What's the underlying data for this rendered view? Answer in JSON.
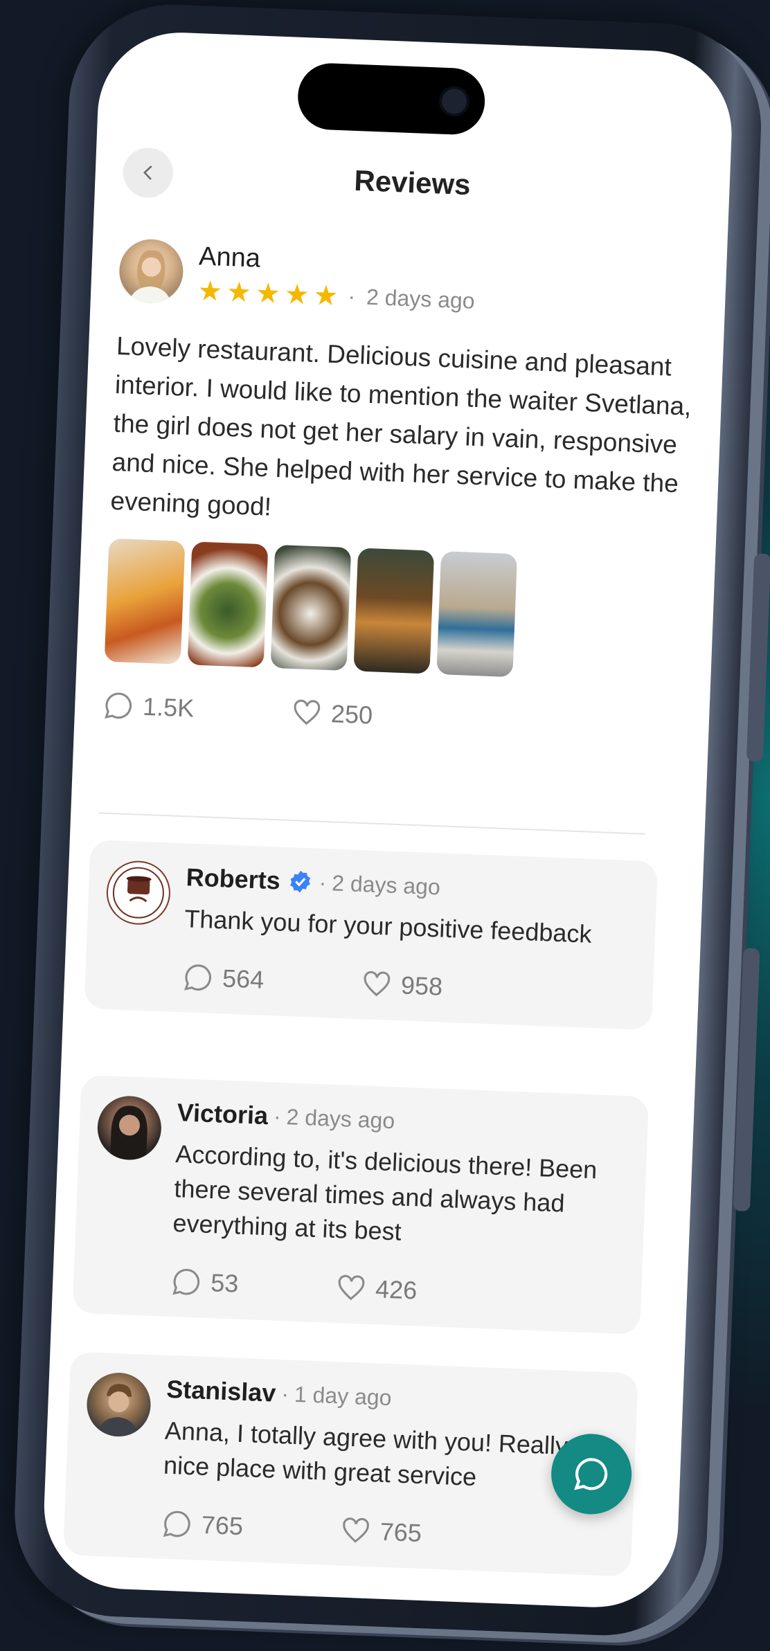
{
  "header": {
    "title": "Reviews"
  },
  "main_review": {
    "author": "Anna",
    "stars": 5,
    "time": "2 days ago",
    "text": "Lovely restaurant. Delicious cuisine and pleasant interior. I would like to mention the waiter Svetlana, the girl does not get her salary in vain, responsive and nice. She helped with her service to make the evening good!",
    "comments": "1.5K",
    "likes": "250"
  },
  "replies": [
    {
      "author": "Roberts",
      "verified": true,
      "time": "2 days ago",
      "text": "Thank you for your positive feedback",
      "comments": "564",
      "likes": "958"
    },
    {
      "author": "Victoria",
      "time": "2 days ago",
      "text": "According to, it's delicious there! Been there several times and always had everything at its best",
      "comments": "53",
      "likes": "426"
    },
    {
      "author": "Stanislav",
      "time": "1 day ago",
      "text": "Anna, I totally agree with you! Really nice place with great service",
      "comments": "765",
      "likes": "765"
    }
  ],
  "colors": {
    "accent": "#138a84",
    "star": "#f5b800",
    "verified": "#3b82f6"
  },
  "icons": {
    "back": "chevron-left-icon",
    "comment": "comment-icon",
    "like": "heart-icon",
    "fab": "chat-icon"
  }
}
